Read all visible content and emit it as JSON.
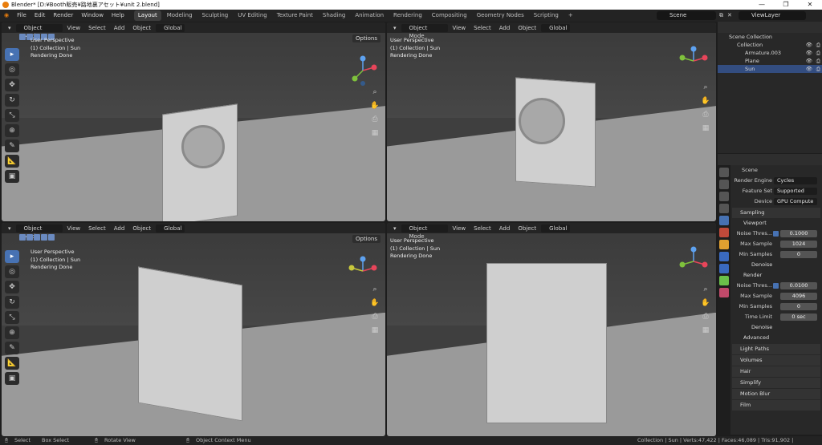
{
  "window": {
    "title": "Blender* [D:¥Booth販売¥路地裏アセット¥unit 2.blend]",
    "controls": [
      "—",
      "❐",
      "✕"
    ]
  },
  "menu": [
    "File",
    "Edit",
    "Render",
    "Window",
    "Help"
  ],
  "workspaces": [
    "Layout",
    "Modeling",
    "Sculpting",
    "UV Editing",
    "Texture Paint",
    "Shading",
    "Animation",
    "Rendering",
    "Compositing",
    "Geometry Nodes",
    "Scripting"
  ],
  "active_workspace": "Layout",
  "scene": "Scene",
  "view_layer": "ViewLayer",
  "viewports": [
    {
      "mode": "Object Mode",
      "menus": [
        "View",
        "Select",
        "Add",
        "Object"
      ],
      "orientation": "Global",
      "options": "Options",
      "info": [
        "User Perspective",
        "(1) Collection | Sun",
        "Rendering Done"
      ]
    },
    {
      "mode": "Object Mode",
      "menus": [
        "View",
        "Select",
        "Add",
        "Object"
      ],
      "orientation": "Global",
      "options": "Options",
      "info": [
        "User Perspective",
        "(1) Collection | Sun",
        "Rendering Done"
      ]
    },
    {
      "mode": "Object Mode",
      "menus": [
        "View",
        "Select",
        "Add",
        "Object"
      ],
      "orientation": "Global",
      "options": "Options",
      "info": [
        "User Perspective",
        "(1) Collection | Sun",
        "Rendering Done"
      ]
    },
    {
      "mode": "Object Mode",
      "menus": [
        "View",
        "Select",
        "Add",
        "Object"
      ],
      "orientation": "Global",
      "options": "Options",
      "info": [
        "User Perspective",
        "(1) Collection | Sun",
        "Rendering Done"
      ]
    }
  ],
  "outliner": {
    "rows": [
      {
        "label": "Scene Collection",
        "indent": 0,
        "selected": false
      },
      {
        "label": "Collection",
        "indent": 1,
        "selected": false
      },
      {
        "label": "Armature.003",
        "indent": 2,
        "selected": false
      },
      {
        "label": "Plane",
        "indent": 2,
        "selected": false
      },
      {
        "label": "Sun",
        "indent": 2,
        "selected": true
      }
    ]
  },
  "properties": {
    "context": "Scene",
    "render_engine_label": "Render Engine",
    "render_engine": "Cycles",
    "feature_set_label": "Feature Set",
    "feature_set": "Supported",
    "device_label": "Device",
    "device": "GPU Compute",
    "sampling": "Sampling",
    "viewport": "Viewport",
    "vp_noise_label": "Noise Thres...",
    "vp_noise": "0.1000",
    "vp_max_label": "Max Sample",
    "vp_max": "1024",
    "vp_min_label": "Min Samples",
    "vp_min": "0",
    "vp_denoise": "Denoise",
    "render": "Render",
    "r_noise_label": "Noise Thres...",
    "r_noise": "0.0100",
    "r_max_label": "Max Sample",
    "r_max": "4096",
    "r_min_label": "Min Samples",
    "r_min": "0",
    "time_limit_label": "Time Limit",
    "time_limit": "0 sec",
    "r_denoise": "Denoise",
    "advanced": "Advanced",
    "light_paths": "Light Paths",
    "volumes": "Volumes",
    "hair": "Hair",
    "simplify": "Simplify",
    "motion_blur": "Motion Blur",
    "film": "Film"
  },
  "status": {
    "select": "Select",
    "box_select": "Box Select",
    "rotate_view": "Rotate View",
    "context_menu": "Object Context Menu",
    "stats": "Collection | Sun | Verts:47,422 | Faces:46,089 | Tris:91,902 | Objects:1/10 | 3.0.0"
  }
}
